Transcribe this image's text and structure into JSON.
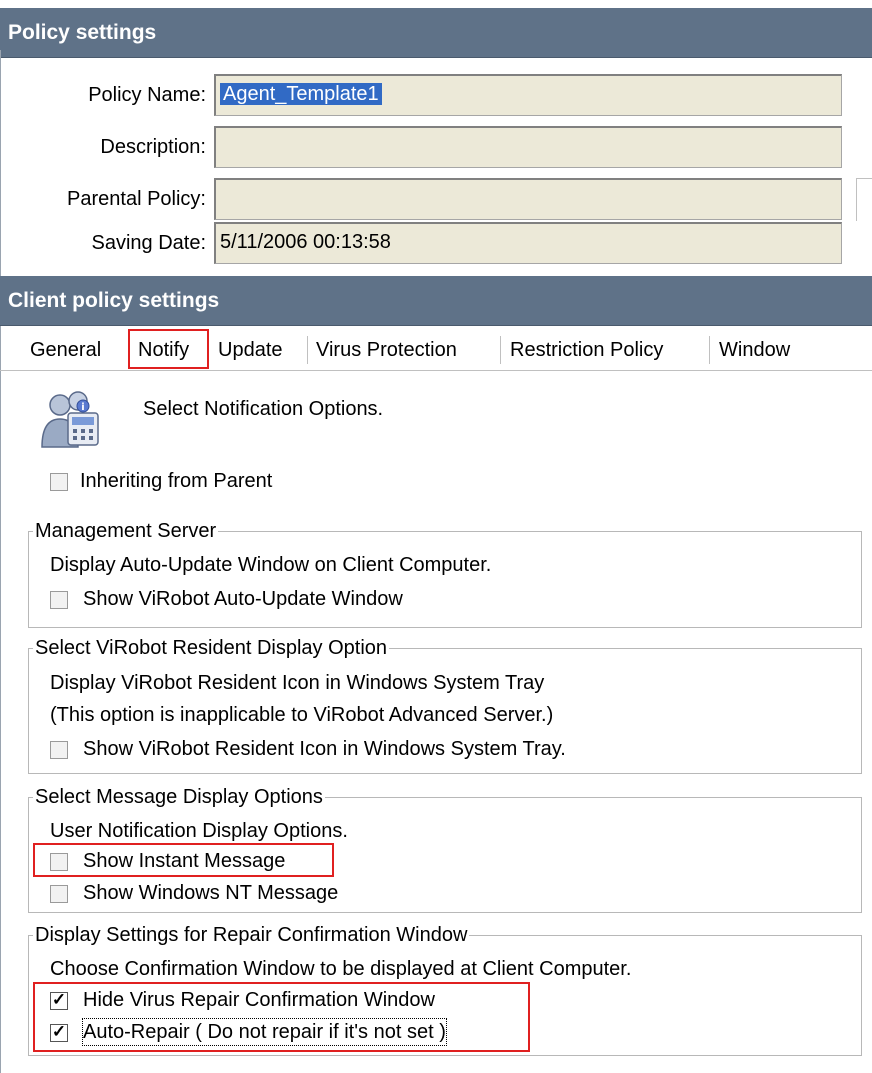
{
  "policy": {
    "header": "Policy settings",
    "fields": [
      {
        "label": "Policy Name:",
        "value": "Agent_Template1"
      },
      {
        "label": "Description:",
        "value": ""
      },
      {
        "label": "Parental Policy:",
        "value": ""
      },
      {
        "label": "Saving Date:",
        "value": "5/11/2006 00:13:58"
      }
    ]
  },
  "client": {
    "header": "Client policy settings",
    "tabs": [
      "General",
      "Notify",
      "Update",
      "Virus Protection",
      "Restriction Policy",
      "Window"
    ],
    "active_tab": "Notify"
  },
  "notify": {
    "icon": "notification-options-icon",
    "title": "Select Notification Options.",
    "inherit": {
      "label": "Inheriting from Parent",
      "checked": false
    },
    "groups": [
      {
        "legend": "Management Server",
        "lines": [
          "Display Auto-Update Window on Client Computer."
        ],
        "options": [
          {
            "label": "Show ViRobot Auto-Update Window",
            "checked": false
          }
        ]
      },
      {
        "legend": "Select ViRobot Resident Display Option",
        "lines": [
          "Display ViRobot Resident Icon in Windows System Tray",
          "(This option is inapplicable to ViRobot Advanced Server.)"
        ],
        "options": [
          {
            "label": "Show ViRobot Resident Icon in Windows System Tray.",
            "checked": false
          }
        ]
      },
      {
        "legend": "Select Message Display Options",
        "lines": [
          "User Notification Display Options."
        ],
        "options": [
          {
            "label": "Show Instant Message",
            "checked": false
          },
          {
            "label": "Show Windows NT Message",
            "checked": false
          }
        ]
      },
      {
        "legend": "Display Settings for Repair Confirmation Window",
        "lines": [
          "Choose Confirmation Window to be displayed at Client Computer."
        ],
        "options": [
          {
            "label": "Hide Virus Repair Confirmation Window",
            "checked": true
          },
          {
            "label": "Auto-Repair ( Do not repair if it's not set )",
            "checked": true
          }
        ]
      }
    ]
  },
  "colors": {
    "header_bg": "#5f7288",
    "highlight": "#e02020",
    "selection": "#316ac5"
  }
}
